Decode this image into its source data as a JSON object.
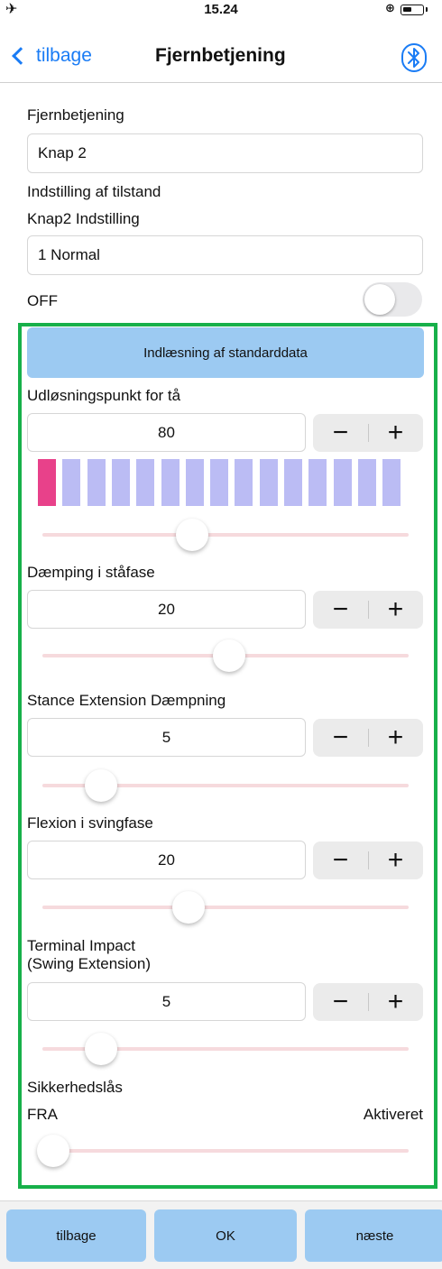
{
  "status_bar": {
    "time": "15.24",
    "airplane_icon": "airplane-icon",
    "rotation_lock_icon": "rotation-lock-icon",
    "battery_icon": "battery-icon"
  },
  "nav": {
    "back_label": "tilbage",
    "title": "Fjernbetjening",
    "bluetooth_icon": "bluetooth-icon"
  },
  "remote": {
    "label": "Fjernbetjening",
    "value": "Knap 2"
  },
  "mode": {
    "section_label": "Indstilling af tilstand",
    "label": "Knap2 Indstilling",
    "value": "1 Normal"
  },
  "toggle": {
    "label": "OFF",
    "on": false
  },
  "load_defaults_label": "Indlæsning af standarddata",
  "settings": [
    {
      "label": "Udløsningspunkt for tå",
      "value": "80",
      "slider_fraction": 0.41
    },
    {
      "label": "Dæmping i ståfase",
      "value": "20",
      "slider_fraction": 0.51
    },
    {
      "label": "Stance Extension Dæmpning",
      "value": "5",
      "slider_fraction": 0.16
    },
    {
      "label": "Flexion i svingfase",
      "value": "20",
      "slider_fraction": 0.4
    },
    {
      "label": "Terminal Impact\n(Swing Extension)",
      "value": "5",
      "slider_fraction": 0.16
    }
  ],
  "level_bar": {
    "segments": 15,
    "active_index": 0,
    "active_color": "#e8418a",
    "inactive_color": "#bbbcf4"
  },
  "stepper": {
    "minus": "−",
    "plus": "+"
  },
  "safety_lock": {
    "label": "Sikkerhedslås",
    "left_label": "FRA",
    "right_label": "Aktiveret",
    "slider_fraction": 0.03
  },
  "bottom_bar": {
    "back_label": "tilbage",
    "ok_label": "OK",
    "next_label": "næste"
  },
  "colors": {
    "accent_blue": "#1a7cf5",
    "button_blue": "#9ccaf2",
    "frame_green": "#17b04a",
    "slider_track": "#f6dadd"
  }
}
